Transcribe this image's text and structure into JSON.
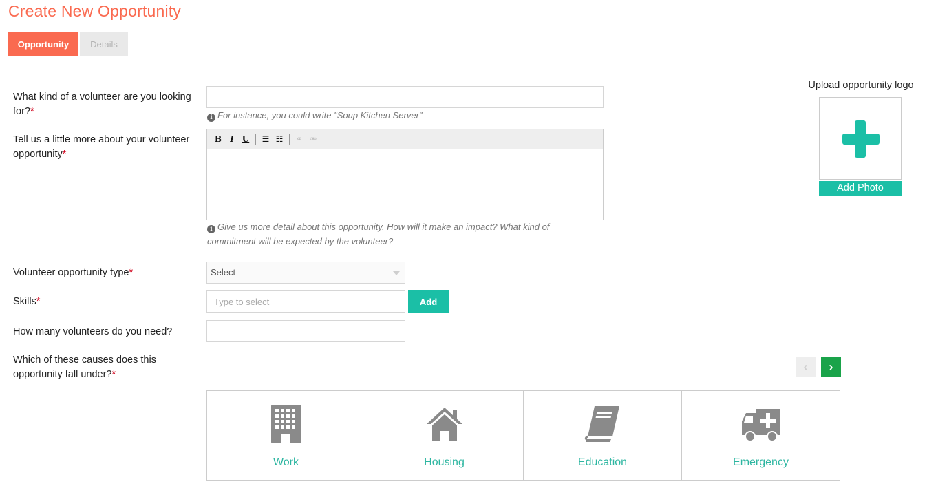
{
  "colors": {
    "accent": "#fa6a50",
    "teal": "#1bbfa6",
    "green": "#1aa34a",
    "icon_gray": "#8a8a8a",
    "cause_text": "#2db6a1"
  },
  "page": {
    "title": "Create New Opportunity"
  },
  "tabs": [
    {
      "label": "Opportunity",
      "active": true
    },
    {
      "label": "Details",
      "active": false
    }
  ],
  "form": {
    "volunteer_kind": {
      "label": "What kind of a volunteer are you looking",
      "label_line2": "for?",
      "required_mark": "*",
      "value": "",
      "placeholder": "",
      "hint": "For instance, you could write \"Soup Kitchen Server\""
    },
    "description": {
      "label": "Tell us a little more about your volunteer",
      "label_line2": "opportunity",
      "required_mark": "*",
      "hint_line1": "Give us more detail about this opportunity. How will it make an impact? What kind of",
      "hint_line2": "commitment will be expected by the volunteer?",
      "toolbar": [
        {
          "icon": "bold-icon",
          "glyph": "B"
        },
        {
          "icon": "italic-icon",
          "glyph": "I"
        },
        {
          "icon": "underline-icon",
          "glyph": "U"
        },
        {
          "icon": "bullet-list-icon",
          "glyph": "☰"
        },
        {
          "icon": "numbered-list-icon",
          "glyph": "☷"
        },
        {
          "icon": "link-icon",
          "glyph": "⚭"
        },
        {
          "icon": "unlink-icon",
          "glyph": "⚮"
        }
      ]
    },
    "opportunity_type": {
      "label": "Volunteer opportunity type",
      "required_mark": "*",
      "selected": "Select"
    },
    "skills": {
      "label": "Skills",
      "required_mark": "*",
      "value": "",
      "placeholder": "Type to select",
      "add_label": "Add"
    },
    "volunteer_count": {
      "label": "How many volunteers do you need?",
      "value": "",
      "placeholder": ""
    },
    "causes": {
      "label": "Which of these causes does this",
      "label_line2": "opportunity fall under?",
      "required_mark": "*",
      "prev_glyph": "‹",
      "next_glyph": "›",
      "items": [
        {
          "label": "Work",
          "icon": "office-building-icon"
        },
        {
          "label": "Housing",
          "icon": "house-icon"
        },
        {
          "label": "Education",
          "icon": "book-icon"
        },
        {
          "label": "Emergency",
          "icon": "ambulance-icon"
        }
      ]
    }
  },
  "upload": {
    "title": "Upload opportunity logo",
    "button_label": "Add Photo",
    "icon": "plus-icon"
  }
}
